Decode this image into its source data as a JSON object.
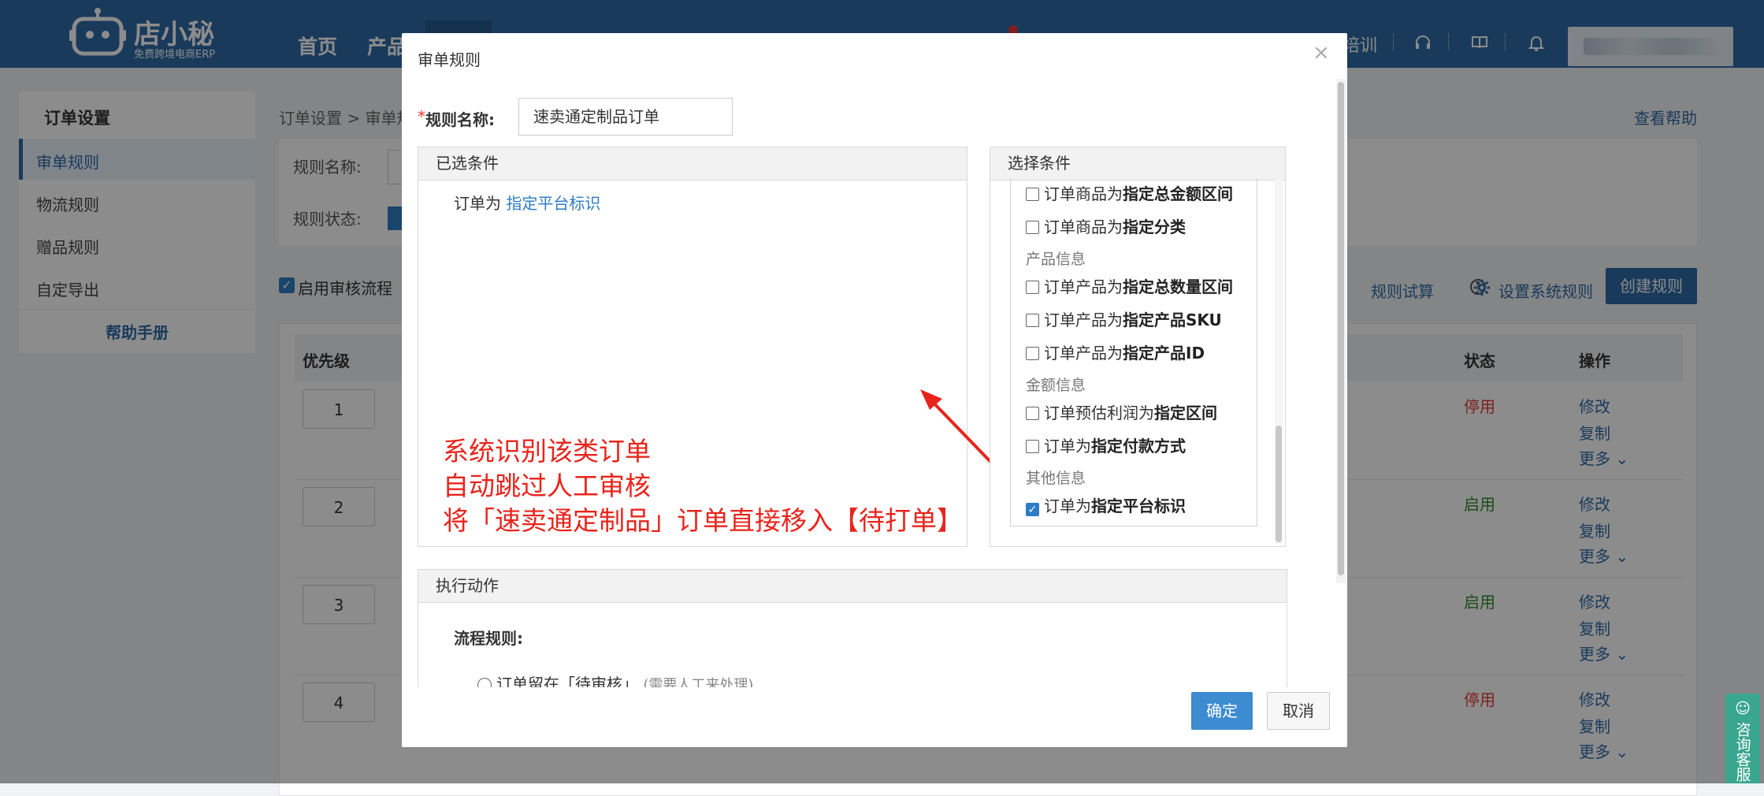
{
  "header": {
    "logo_text": "店小秘",
    "logo_sub": "免费跨境电商ERP",
    "nav": [
      "首页",
      "产品"
    ],
    "right_text": "培训"
  },
  "sidebar": {
    "title": "订单设置",
    "items": [
      "审单规则",
      "物流规则",
      "赠品规则",
      "自定导出"
    ],
    "help": "帮助手册"
  },
  "main": {
    "breadcrumb": "订单设置 > 审单规则",
    "help_link": "查看帮助",
    "filter_name_label": "规则名称:",
    "filter_status_label": "规则状态:",
    "enable_flow_label": "启用审核流程",
    "trial_link": "规则试算",
    "sys_rule_link": "设置系统规则",
    "create_button": "创建规则",
    "columns": {
      "priority": "优先级",
      "status": "状态",
      "ops": "操作"
    },
    "rows": [
      {
        "priority": "1",
        "status": "停用",
        "edit": "修改",
        "copy": "复制",
        "more": "更多"
      },
      {
        "priority": "2",
        "status": "启用",
        "edit": "修改",
        "copy": "复制",
        "more": "更多"
      },
      {
        "priority": "3",
        "status": "启用",
        "edit": "修改",
        "copy": "复制",
        "more": "更多"
      },
      {
        "priority": "4",
        "status": "停用",
        "edit": "修改",
        "copy": "复制",
        "more": "更多"
      }
    ]
  },
  "modal": {
    "title": "审单规则",
    "close": "×",
    "rule_name_label": "规则名称:",
    "rule_name_value": "速卖通定制品订单",
    "selected_panel_title": "已选条件",
    "selected_condition_prefix": "订单为",
    "selected_condition_highlight": "指定平台标识",
    "choose_panel_title": "选择条件",
    "annotation_lines": [
      "系统识别该类订单",
      "自动跳过人工审核",
      "将「速卖通定制品」订单直接移入【待打单】"
    ],
    "conditions": [
      {
        "type": "item",
        "prefix": "订单商品为",
        "bold": "指定总金额区间",
        "checked": false
      },
      {
        "type": "item",
        "prefix": "订单商品为",
        "bold": "指定分类",
        "checked": false
      },
      {
        "type": "group",
        "label": "产品信息"
      },
      {
        "type": "item",
        "prefix": "订单产品为",
        "bold": "指定总数量区间",
        "checked": false
      },
      {
        "type": "item",
        "prefix": "订单产品为",
        "bold": "指定产品SKU",
        "checked": false
      },
      {
        "type": "item",
        "prefix": "订单产品为",
        "bold": "指定产品ID",
        "checked": false
      },
      {
        "type": "group",
        "label": "金额信息"
      },
      {
        "type": "item",
        "prefix": "订单预估利润为",
        "bold": "指定区间",
        "checked": false
      },
      {
        "type": "item",
        "prefix": "订单为",
        "bold": "指定付款方式",
        "checked": false
      },
      {
        "type": "group",
        "label": "其他信息"
      },
      {
        "type": "item",
        "prefix": "订单为",
        "bold": "指定平台标识",
        "checked": true
      }
    ],
    "action_panel_title": "执行动作",
    "flow_rule_label": "流程规则:",
    "radio_option": "订单留在「待审核」",
    "radio_option_note": "(需要人工来处理)",
    "ok": "确定",
    "cancel": "取消"
  },
  "float_widget": "咨询客服",
  "colors": {
    "brand": "#2e6aa6",
    "accent": "#2e7cc5",
    "annotation": "#e8241c",
    "disabled": "#e53935",
    "enabled": "#2e8b2e"
  }
}
